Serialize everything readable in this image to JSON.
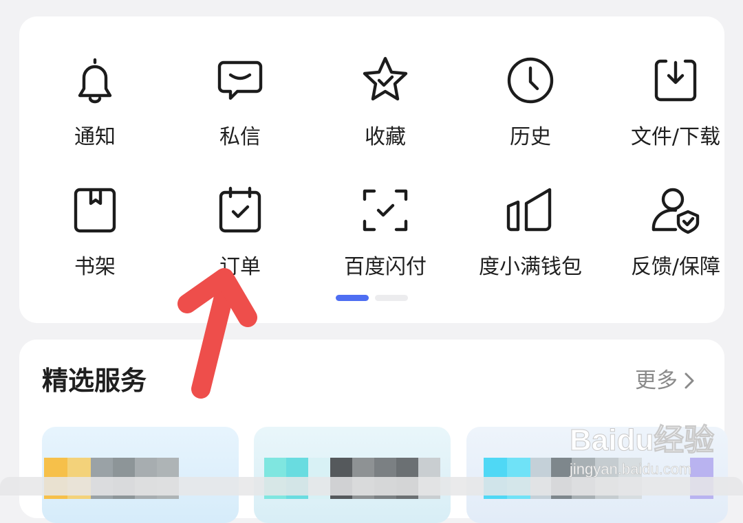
{
  "quick_actions": [
    {
      "label": "通知",
      "icon": "bell-icon"
    },
    {
      "label": "私信",
      "icon": "message-icon"
    },
    {
      "label": "收藏",
      "icon": "star-icon"
    },
    {
      "label": "历史",
      "icon": "clock-icon"
    },
    {
      "label": "文件/下载",
      "icon": "download-icon"
    },
    {
      "label": "书架",
      "icon": "bookshelf-icon"
    },
    {
      "label": "订单",
      "icon": "calendar-check-icon"
    },
    {
      "label": "百度闪付",
      "icon": "scan-check-icon"
    },
    {
      "label": "度小满钱包",
      "icon": "wallet-icon"
    },
    {
      "label": "反馈/保障",
      "icon": "user-shield-icon"
    }
  ],
  "pager": {
    "active_index": 0,
    "page_count": 2,
    "active_color": "#4e6ef2"
  },
  "services": {
    "title": "精选服务",
    "more_label": "更多"
  },
  "watermark": {
    "text": "Baidu经验",
    "sub": "jingyan.baidu.com"
  },
  "annotation": {
    "arrow_color": "#ee4e4b"
  }
}
